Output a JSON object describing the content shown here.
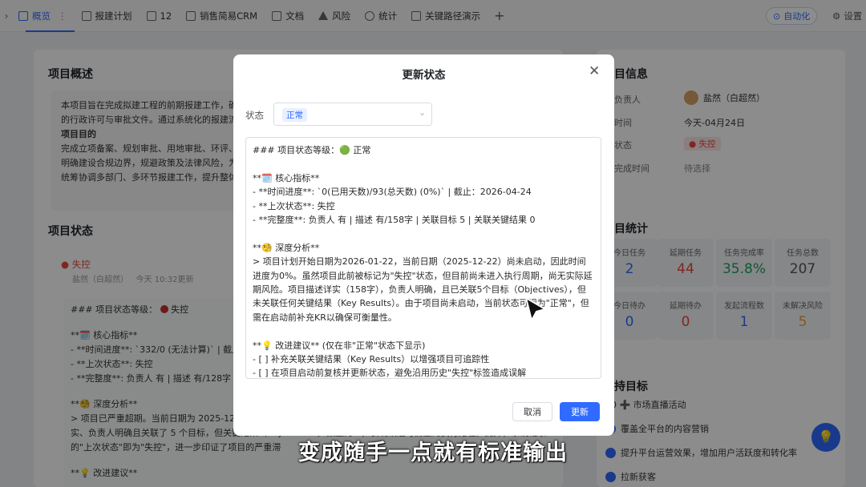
{
  "tabs": [
    {
      "label": "概览",
      "icon": "overview-icon",
      "active": true
    },
    {
      "label": "报建计划",
      "icon": "table-icon"
    },
    {
      "label": "12",
      "icon": "doc-icon"
    },
    {
      "label": "销售简易CRM",
      "icon": "table-icon"
    },
    {
      "label": "文档",
      "icon": "doc-icon"
    },
    {
      "label": "风险",
      "icon": "warning-icon"
    },
    {
      "label": "统计",
      "icon": "chart-icon"
    },
    {
      "label": "关键路径演示",
      "icon": "table-icon"
    }
  ],
  "toolbar": {
    "automation": "自动化",
    "settings": "设置"
  },
  "overview": {
    "title": "项目概述",
    "line1": "本项目旨在完成拟建工程的前期报建工作，确",
    "line2": "的行政许可与审批文件。通过系统化的报建流",
    "goal_heading": "项目目的",
    "line3": "完成立项备案、规划审批、用地审批、环评、",
    "line4": "明确建设合规边界，规避政策及法律风险，为",
    "line5": "统筹协调多部门、多环节报建工作，提升整体"
  },
  "project_status": {
    "title": "项目状态",
    "tag": "失控",
    "meta_user": "盐然（白超然）",
    "meta_time": "今天 10:32更新",
    "body": [
      "### 项目状态等级：",
      "失控",
      "**🗓️ 核心指标**",
      "- **时间进度**: `332/0 (无法计算)` | 截止：",
      "- **上次状态**: 失控",
      "- **完整度**: 负责人 有 | 描述 有/128字 |",
      "**🧐 深度分析**",
      "> 项目已严重超期。当前日期为 2025-12-",
      "实、负责人明确且关联了 5 个目标，但关键结果（Key Results）数量为 0，表明缺乏可衡量的执行路径。此外，系统记录",
      "的\"上次状态\"即为\"失控\"，进一步印证了项目的严重滞",
      "**💡 改进建议**"
    ]
  },
  "info": {
    "title": "目信息",
    "owner_label": "负责人",
    "owner_value": "盐然（白超然）",
    "time_label": "时间",
    "time_value": "今天-04月24日",
    "status_label": "状态",
    "status_value": "失控",
    "done_label": "完成时间",
    "done_value": "待选择"
  },
  "stats": {
    "title": "目统计",
    "cells": [
      {
        "label": "今日任务",
        "value": "2",
        "color": "#2f6bff"
      },
      {
        "label": "延期任务",
        "value": "44",
        "color": "#e5483f"
      },
      {
        "label": "任务完成率",
        "value": "35.8%",
        "color": "#1aa35f"
      },
      {
        "label": "任务总数",
        "value": "207",
        "color": "#555555"
      },
      {
        "label": "今日待办",
        "value": "0",
        "color": "#2f6bff"
      },
      {
        "label": "延期待办",
        "value": "0",
        "color": "#e5483f"
      },
      {
        "label": "发起流程数",
        "value": "1",
        "color": "#2f6bff"
      },
      {
        "label": "未解决风险",
        "value": "5",
        "color": "#e8a23a"
      }
    ]
  },
  "goals": {
    "title": "持目标",
    "items": [
      "20 ➕ 市场直播活动",
      "覆盖全平台的内容营销",
      "提升平台运营效果，增加用户活跃度和转化率",
      "拉新获客"
    ]
  },
  "modal": {
    "title": "更新状态",
    "status_label": "状态",
    "status_value": "正常",
    "content": [
      "### 项目状态等级：🟢 正常",
      "",
      "**🗓️ 核心指标**",
      "- **时间进度**: `0(已用天数)/93(总天数) (0%)` | 截止：2026-04-24",
      "- **上次状态**: 失控",
      "- **完整度**: 负责人 有 | 描述 有/158字 | 关联目标 5 | 关联关键结果 0",
      "",
      "**🧐 深度分析**",
      "> 项目计划开始日期为2026-01-22，当前日期（2025-12-22）尚未启动，因此时间进度为0%。虽然项目此前被标记为\"失控\"状态，但目前尚未进入执行周期，尚无实际延期风险。项目描述详实（158字），负责人明确，且已关联5个目标（Objectives），但未关联任何关键结果（Key Results）。由于项目尚未启动，当前状态可视为\"正常\"，但需在启动前补充KR以确保可衡量性。",
      "",
      "**💡 改进建议** (仅在非\"正常\"状态下显示)",
      "- [ ] 补充关联关键结果（Key Results）以增强项目可追踪性",
      "- [ ] 在项目启动前复核并更新状态，避免沿用历史\"失控\"标签造成误解"
    ],
    "cancel": "取消",
    "update": "更新"
  },
  "subtitle": "变成随手一点就有标准输出",
  "colors": {
    "accent": "#2f6bff",
    "danger": "#e5483f",
    "success": "#1aa35f"
  }
}
